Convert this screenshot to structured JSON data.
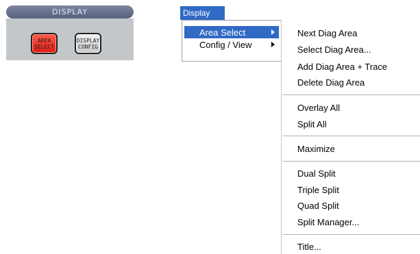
{
  "hw_panel": {
    "header": "DISPLAY",
    "area_select_key": "AREA\nSELECT",
    "display_config_key": "DISPLAY\nCONFIG"
  },
  "menubar": {
    "title": "Display"
  },
  "menu": {
    "items": [
      {
        "label": "Area Select",
        "has_submenu": true,
        "active": true
      },
      {
        "label": "Config / View",
        "has_submenu": true,
        "active": false
      }
    ]
  },
  "submenu": {
    "groups": [
      [
        "Next Diag Area",
        "Select Diag Area...",
        "Add Diag Area + Trace",
        "Delete Diag Area"
      ],
      [
        "Overlay All",
        "Split All"
      ],
      [
        "Maximize"
      ],
      [
        "Dual Split",
        "Triple Split",
        "Quad Split",
        "Split Manager..."
      ],
      [
        "Title..."
      ]
    ]
  },
  "colors": {
    "menu_highlight": "#316ac5",
    "panel_header": "#56607e",
    "panel_body": "#c4c7ca",
    "key_red": "#e01a10"
  }
}
